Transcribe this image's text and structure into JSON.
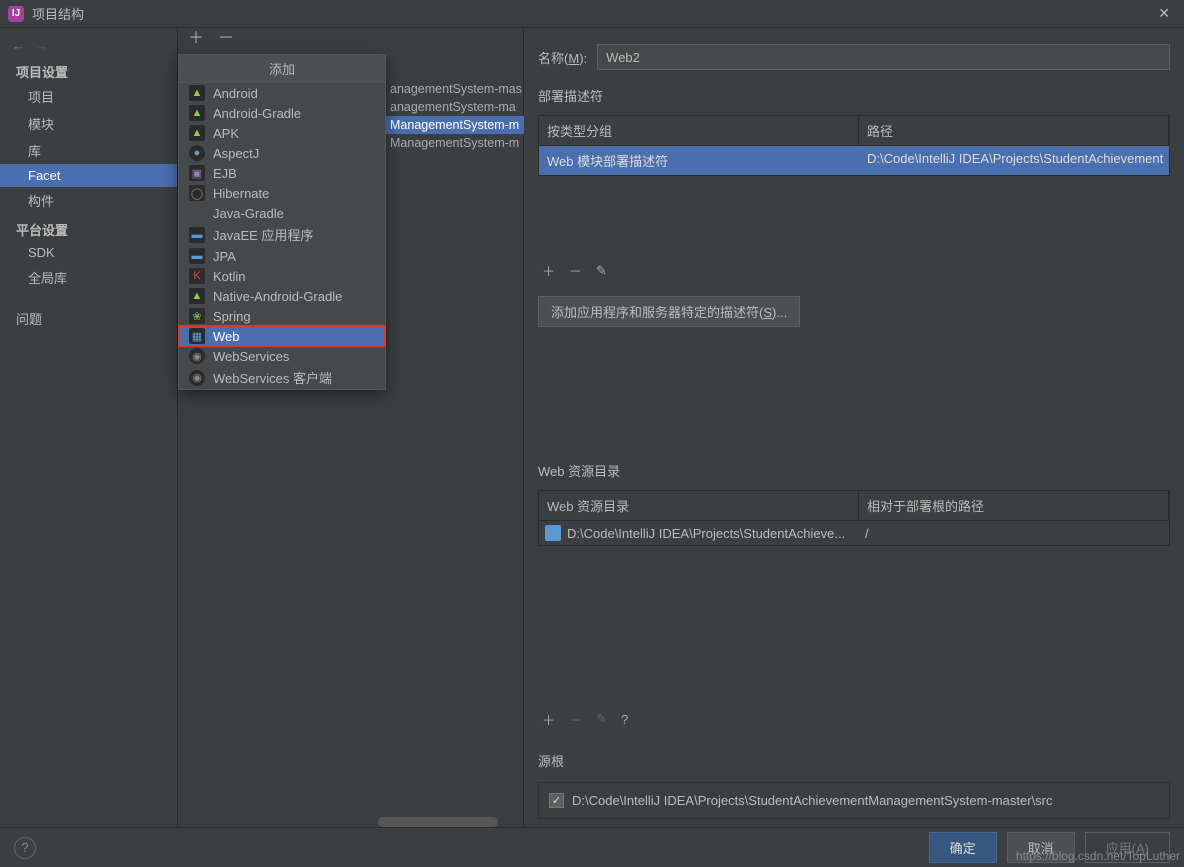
{
  "window": {
    "title": "项目结构"
  },
  "sidebar": {
    "section1": "项目设置",
    "items1": [
      "项目",
      "模块",
      "库",
      "Facet",
      "构件"
    ],
    "section2": "平台设置",
    "items2": [
      "SDK",
      "全局库"
    ],
    "issues": "问题"
  },
  "popup": {
    "title": "添加",
    "items": [
      {
        "label": "Android",
        "icon": "android"
      },
      {
        "label": "Android-Gradle",
        "icon": "android"
      },
      {
        "label": "APK",
        "icon": "apk"
      },
      {
        "label": "AspectJ",
        "icon": "aspectj"
      },
      {
        "label": "EJB",
        "icon": "ejb"
      },
      {
        "label": "Hibernate",
        "icon": "hib"
      },
      {
        "label": "Java-Gradle",
        "icon": ""
      },
      {
        "label": "JavaEE 应用程序",
        "icon": "javaee"
      },
      {
        "label": "JPA",
        "icon": "jpa"
      },
      {
        "label": "Kotlin",
        "icon": "kotlin"
      },
      {
        "label": "Native-Android-Gradle",
        "icon": "android"
      },
      {
        "label": "Spring",
        "icon": "spring"
      },
      {
        "label": "Web",
        "icon": "web",
        "selected": true
      },
      {
        "label": "WebServices",
        "icon": "ws"
      },
      {
        "label": "WebServices 客户端",
        "icon": "ws"
      }
    ]
  },
  "modules": [
    "anagementSystem-mas",
    "anagementSystem-ma",
    "ManagementSystem-m",
    "ManagementSystem-m"
  ],
  "right": {
    "name_label": "名称",
    "name_key": "M",
    "name_value": "Web2",
    "deploy_title": "部署描述符",
    "deploy_headers": [
      "按类型分组",
      "路径"
    ],
    "deploy_row": [
      "Web 模块部署描述符",
      "D:\\Code\\IntelliJ IDEA\\Projects\\StudentAchievement"
    ],
    "add_descriptor_btn": "添加应用程序和服务器特定的描述符(",
    "add_descriptor_key": "S",
    "add_descriptor_suffix": ")...",
    "res_title": "Web 资源目录",
    "res_headers": [
      "Web 资源目录",
      "相对于部署根的路径"
    ],
    "res_row": [
      "D:\\Code\\IntelliJ IDEA\\Projects\\StudentAchieve...",
      "/"
    ],
    "src_title": "源根",
    "src_path": "D:\\Code\\IntelliJ IDEA\\Projects\\StudentAchievementManagementSystem-master\\src"
  },
  "footer": {
    "ok": "确定",
    "cancel": "取消",
    "apply": "应用",
    "apply_key": "A"
  },
  "watermark": "https://blog.csdn.net/TopLuther"
}
